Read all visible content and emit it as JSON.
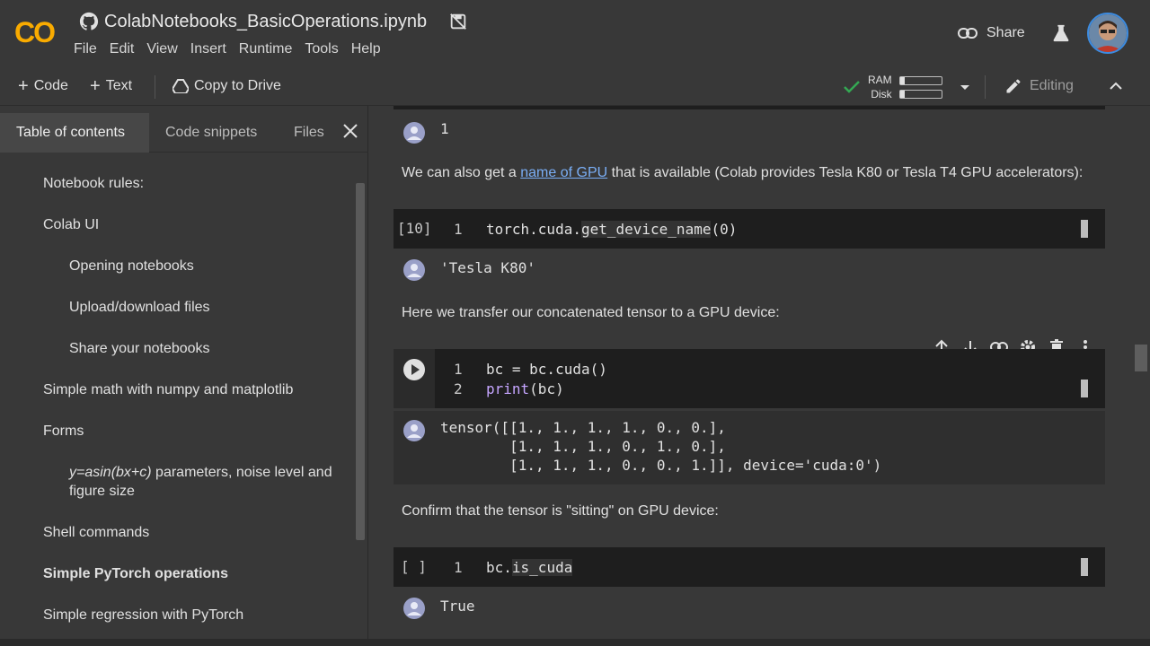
{
  "header": {
    "logo_text": "CO",
    "title": "ColabNotebooks_BasicOperations.ipynb",
    "menu": [
      "File",
      "Edit",
      "View",
      "Insert",
      "Runtime",
      "Tools",
      "Help"
    ],
    "share_label": "Share"
  },
  "toolbar": {
    "code_label": "Code",
    "text_label": "Text",
    "drive_label": "Copy to Drive",
    "ram_label": "RAM",
    "disk_label": "Disk",
    "ram_level": 0.12,
    "disk_level": 0.12,
    "editing_label": "Editing"
  },
  "sidebar": {
    "tabs": [
      "Table of contents",
      "Code snippets",
      "Files"
    ],
    "toc": [
      "Notebook rules:",
      "Colab UI",
      "Opening notebooks",
      "Upload/download files",
      "Share your notebooks",
      "Simple math with numpy and matplotlib",
      "Forms",
      "y=asin(bx+c)",
      " parameters, noise level and",
      "figure size",
      "Shell commands",
      "Simple PyTorch operations",
      "Simple regression with PyTorch"
    ]
  },
  "main": {
    "out1": "1",
    "md1_pre": "We can also get a ",
    "md1_link": "name of GPU",
    "md1_post": " that is available (Colab provides Tesla K80 or Tesla T4 GPU accelerators):",
    "cell1_count": "[10]",
    "cell1_line_no": "1",
    "cell1_code_a": "torch.cuda.",
    "cell1_code_b": "get_device_name",
    "cell1_code_c": "(0)",
    "out2": "'Tesla K80'",
    "md2": "Here we transfer our concatenated tensor to a GPU device:",
    "cell2_line1_no": "1",
    "cell2_line1": "bc = bc.cuda()",
    "cell2_line2_no": "2",
    "cell2_line2_kw": "print",
    "cell2_line2_rest": "(bc)",
    "out3_l1": "tensor([[1., 1., 1., 1., 0., 0.],",
    "out3_l2": "        [1., 1., 1., 0., 1., 0.],",
    "out3_l3": "        [1., 1., 1., 0., 0., 1.]], device='cuda:0')",
    "md3": "Confirm that the tensor is \"sitting\" on GPU device:",
    "cell3_count": "[ ]",
    "cell3_line_no": "1",
    "cell3_code_a": "bc.",
    "cell3_code_b": "is_cuda",
    "out4": "True"
  },
  "colors": {
    "background": "#383838",
    "code_bg": "#1e1e1e",
    "logo_orange": "#f9ab00",
    "link": "#7aaef5",
    "check_green": "#34a853"
  }
}
